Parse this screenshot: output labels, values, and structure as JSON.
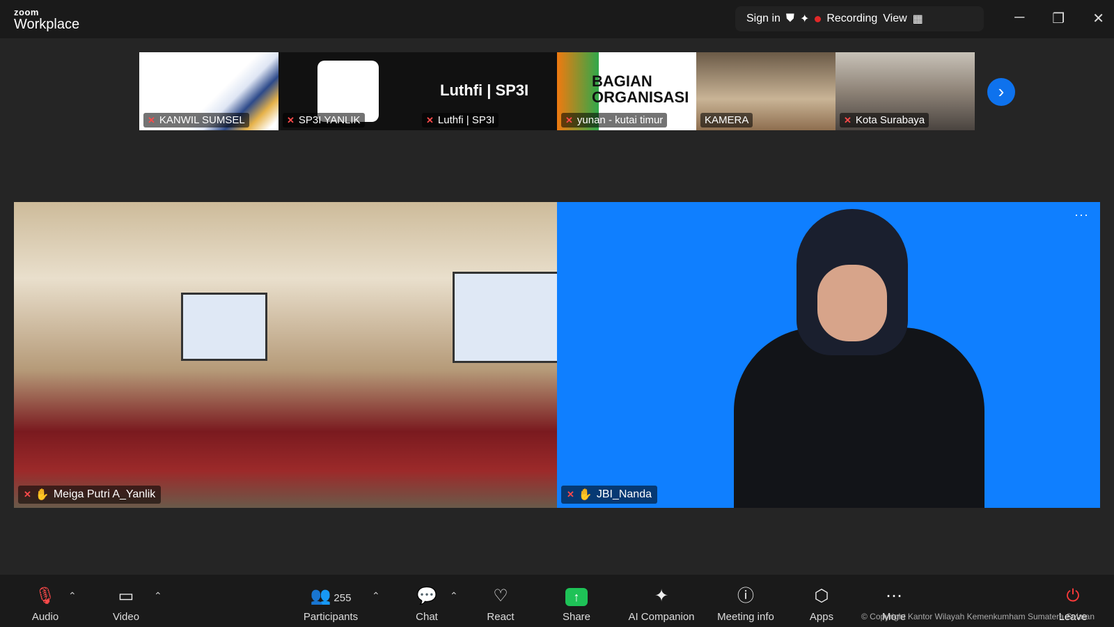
{
  "app": {
    "brand_small": "zoom",
    "brand_big": "Workplace"
  },
  "top": {
    "signin": "Sign in",
    "recording": "Recording",
    "view": "View"
  },
  "window": {
    "minimize": "─",
    "restore": "❐",
    "close": "✕"
  },
  "thumbnails": [
    {
      "name": "KANWIL SUMSEL"
    },
    {
      "name": "SP3I YANLIK"
    },
    {
      "name": "Luthfi | SP3I",
      "big_text": "Luthfi | SP3I"
    },
    {
      "name": "yunan - kutai timur",
      "org_text": "BAGIAN ORGANISASI"
    },
    {
      "name": "KAMERA"
    },
    {
      "name": "Kota Surabaya"
    }
  ],
  "tiles": {
    "left": {
      "name": "Meiga Putri A_Yanlik"
    },
    "right": {
      "name": "JBI_Nanda",
      "more": "···"
    }
  },
  "toolbar": {
    "audio": "Audio",
    "video": "Video",
    "participants": "Participants",
    "participants_count": "255",
    "chat": "Chat",
    "react": "React",
    "share": "Share",
    "ai": "AI Companion",
    "info": "Meeting info",
    "apps": "Apps",
    "more": "More",
    "leave": "Leave"
  },
  "footer": {
    "copyright": "© Copyright Kantor Wilayah Kemenkumham Sumatera Selatan"
  },
  "colors": {
    "accent": "#0e72ed",
    "share": "#1ec257",
    "record": "#e02828",
    "tile_bg": "#0f7fff"
  }
}
